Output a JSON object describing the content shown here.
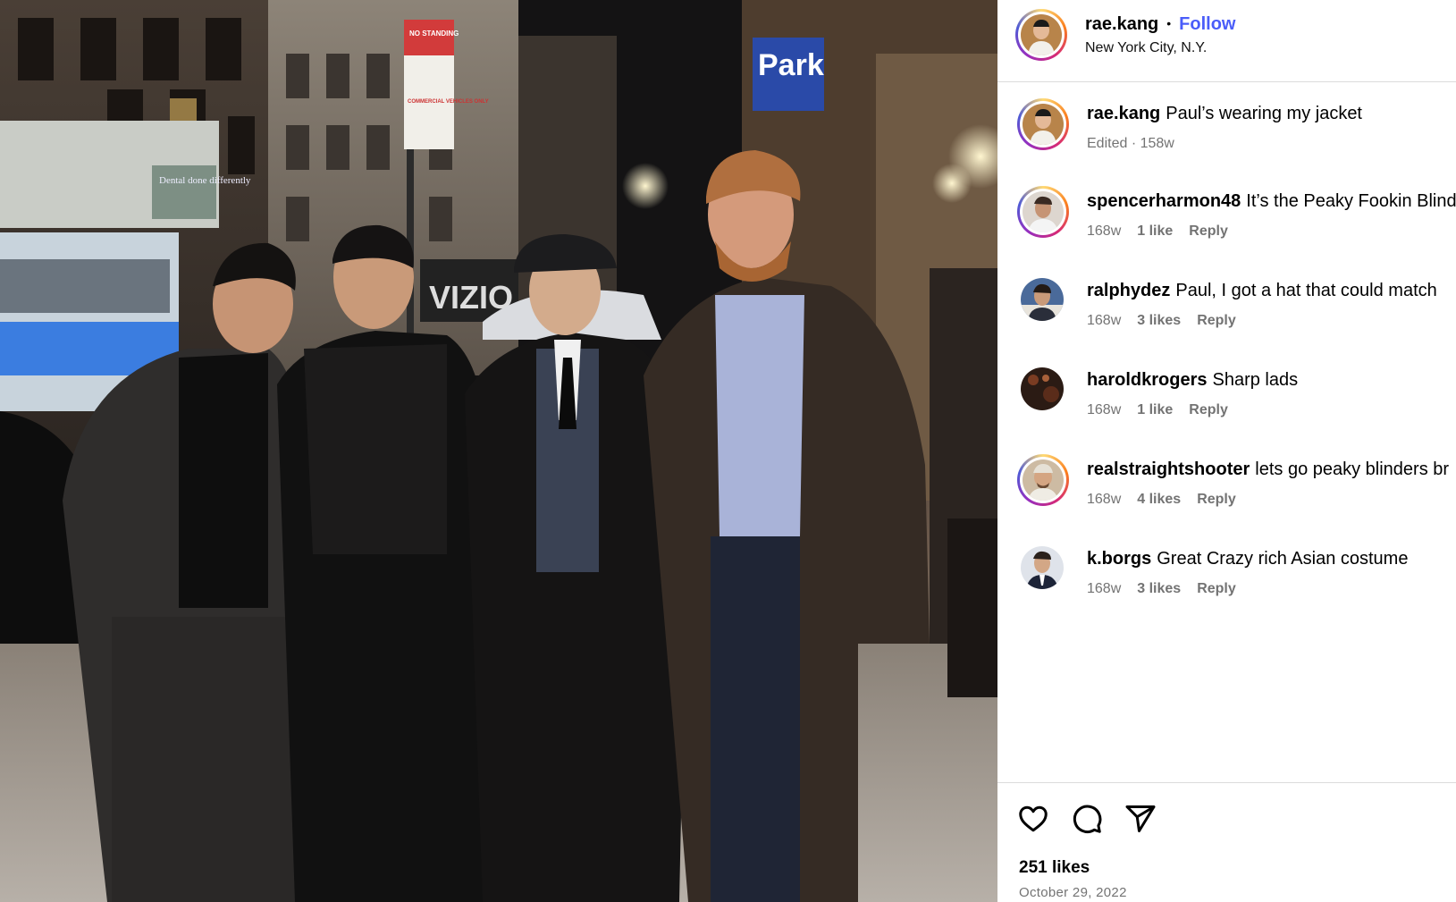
{
  "post": {
    "author": "rae.kang",
    "follow_label": "Follow",
    "separator": "•",
    "location": "New York City, N.Y.",
    "caption": "Paul’s wearing my jacket",
    "caption_meta": "Edited · 158w",
    "likes": "251 likes",
    "date": "October 29, 2022"
  },
  "comments": [
    {
      "user": "spencerharmon48",
      "text": "It’s the Peaky Fookin Blinde",
      "time": "168w",
      "likes": "1 like",
      "reply": "Reply"
    },
    {
      "user": "ralphydez",
      "text": "Paul, I got a hat that could match",
      "time": "168w",
      "likes": "3 likes",
      "reply": "Reply"
    },
    {
      "user": "haroldkrogers",
      "text": "Sharp lads",
      "time": "168w",
      "likes": "1 like",
      "reply": "Reply"
    },
    {
      "user": "realstraightshooter",
      "text": "lets go peaky blinders br",
      "time": "168w",
      "likes": "4 likes",
      "reply": "Reply"
    },
    {
      "user": "k.borgs",
      "text": "Great Crazy rich Asian costume",
      "time": "168w",
      "likes": "3 likes",
      "reply": "Reply"
    }
  ],
  "photo_signs": {
    "sign_top": "NO STANDING",
    "sign_mid": "COMMERCIAL VEHICLES ONLY",
    "parking": "Park",
    "store": "VIZIO",
    "dental": "Dental done differently"
  },
  "colors": {
    "follow_blue": "#4a5df9",
    "meta_gray": "#737373",
    "divider": "#dbdbdb"
  },
  "icons": [
    "heart-icon",
    "comment-icon",
    "share-icon"
  ]
}
